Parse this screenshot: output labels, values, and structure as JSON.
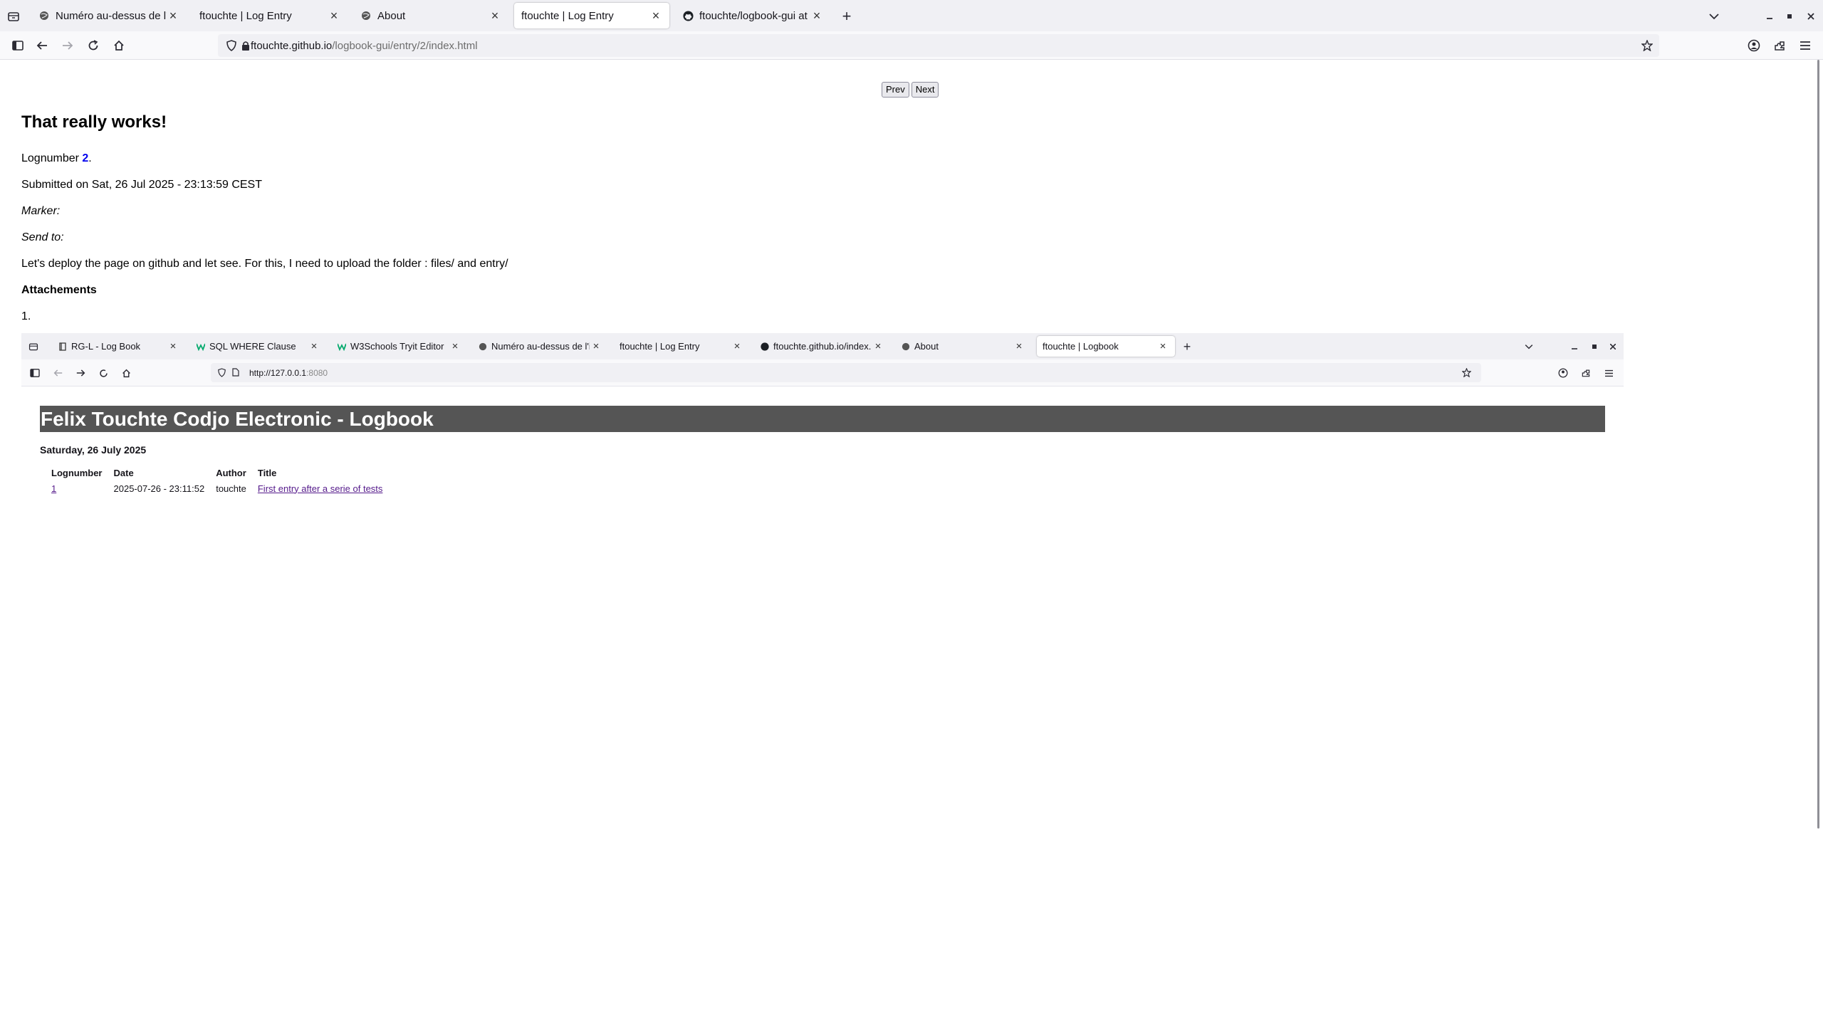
{
  "browser": {
    "tabs": [
      {
        "label": "Numéro au-dessus de l'im",
        "icon": "globe-icon"
      },
      {
        "label": "ftouchte | Log Entry",
        "icon": "none"
      },
      {
        "label": "About",
        "icon": "globe-icon"
      },
      {
        "label": "ftouchte | Log Entry",
        "icon": "none"
      },
      {
        "label": "ftouchte/logbook-gui at g",
        "icon": "github-icon"
      }
    ],
    "url": {
      "host": "ftouchte.github.io",
      "path": "/logbook-gui/entry/2/index.html"
    }
  },
  "page": {
    "prev_label": "Prev",
    "next_label": "Next",
    "title": "That really works!",
    "lognumber_prefix": "Lognumber ",
    "lognumber": "2",
    "lognumber_suffix": ".",
    "submitted": "Submitted on Sat, 26 Jul 2025 - 23:13:59 CEST",
    "marker_label": "Marker:",
    "send_to_label": "Send to:",
    "body": "Let's deploy the page on github and let see. For this, I need to upload the folder : files/ and entry/",
    "attachments_heading": "Attachements",
    "attachment_item": "1."
  },
  "screenshot": {
    "tabs": [
      {
        "label": "RG-L - Log Book",
        "icon": "book-icon"
      },
      {
        "label": "SQL WHERE Clause",
        "icon": "w3schools-icon"
      },
      {
        "label": "W3Schools Tryit Editor",
        "icon": "w3schools-icon"
      },
      {
        "label": "Numéro au-dessus de l'im",
        "icon": "globe-icon"
      },
      {
        "label": "ftouchte | Log Entry",
        "icon": "none"
      },
      {
        "label": "ftouchte.github.io/index.",
        "icon": "github-icon"
      },
      {
        "label": "About",
        "icon": "globe-icon"
      },
      {
        "label": "ftouchte | Logbook",
        "icon": "none"
      }
    ],
    "url": {
      "host": "http://127.0.0.1",
      "port": ":8080"
    },
    "banner": "Felix Touchte Codjo Electronic - Logbook",
    "day": "Saturday, 26 July 2025",
    "table": {
      "headers": [
        "Lognumber",
        "Date",
        "Author",
        "Title"
      ],
      "rows": [
        {
          "lognumber": "1",
          "date": "2025-07-26 - 23:11:52",
          "author": "touchte",
          "title": "First entry after a serie of tests"
        }
      ]
    }
  }
}
